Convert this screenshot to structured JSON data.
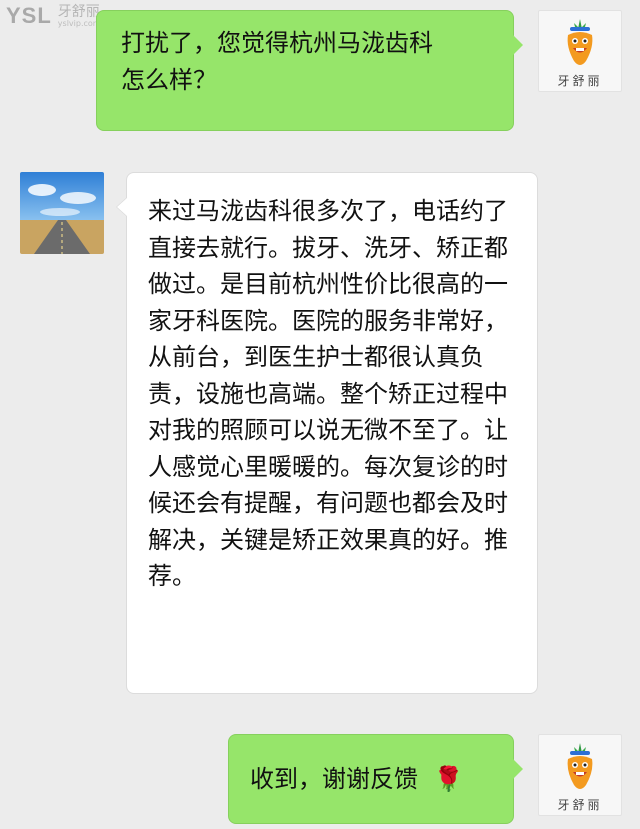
{
  "watermark": {
    "logo": "YSL",
    "brand_cn": "牙舒丽",
    "url": "yslvip.com"
  },
  "messages": [
    {
      "side": "right",
      "text": "打扰了，您觉得杭州马泷齿科\n怎么样？"
    },
    {
      "side": "left",
      "text": "来过马泷齿科很多次了，电话约了直接去就行。拔牙、洗牙、矫正都做过。是目前杭州性价比很高的一家牙科医院。医院的服务非常好，从前台，到医生护士都很认真负责，设施也高端。整个矫正过程中对我的照顾可以说无微不至了。让人感觉心里暖暖的。每次复诊的时候还会有提醒，有问题也都会及时解决，关键是矫正效果真的好。推荐。"
    },
    {
      "side": "right",
      "text": "收到，谢谢反馈",
      "emoji": "🌹"
    }
  ],
  "avatar_brand": "牙舒丽"
}
